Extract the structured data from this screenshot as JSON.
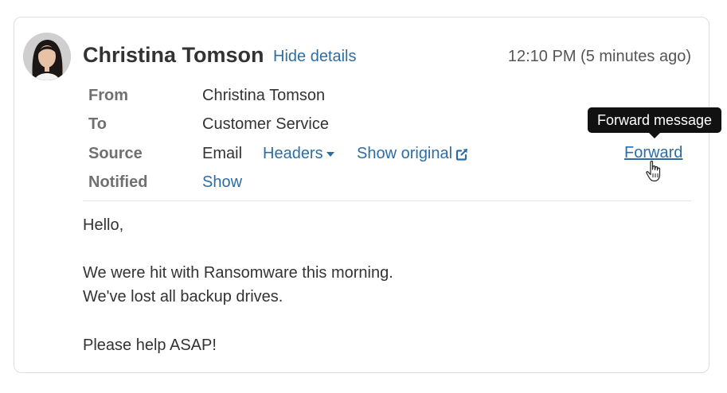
{
  "message": {
    "sender_name": "Christina Tomson",
    "hide_details_label": "Hide details",
    "timestamp": "12:10 PM (5 minutes ago)"
  },
  "details": {
    "from_label": "From",
    "from_value": "Christina Tomson",
    "to_label": "To",
    "to_value": "Customer Service",
    "source_label": "Source",
    "source_value": "Email",
    "headers_label": "Headers",
    "show_original_label": "Show original",
    "notified_label": "Notified",
    "notified_value": "Show"
  },
  "actions": {
    "forward_label": "Forward",
    "forward_tooltip": "Forward message"
  },
  "body": {
    "lines": [
      "Hello,",
      "We were hit with Ransomware this morning.",
      "We've lost all backup drives.",
      "Please help ASAP!"
    ]
  },
  "colors": {
    "link": "#2e6da4",
    "label": "#707070",
    "text": "#333333",
    "tooltip_bg": "#111111"
  },
  "icons": {
    "headers_caret": "caret-down-icon",
    "show_original": "external-link-icon",
    "pointer": "hand-pointer-cursor-icon"
  }
}
